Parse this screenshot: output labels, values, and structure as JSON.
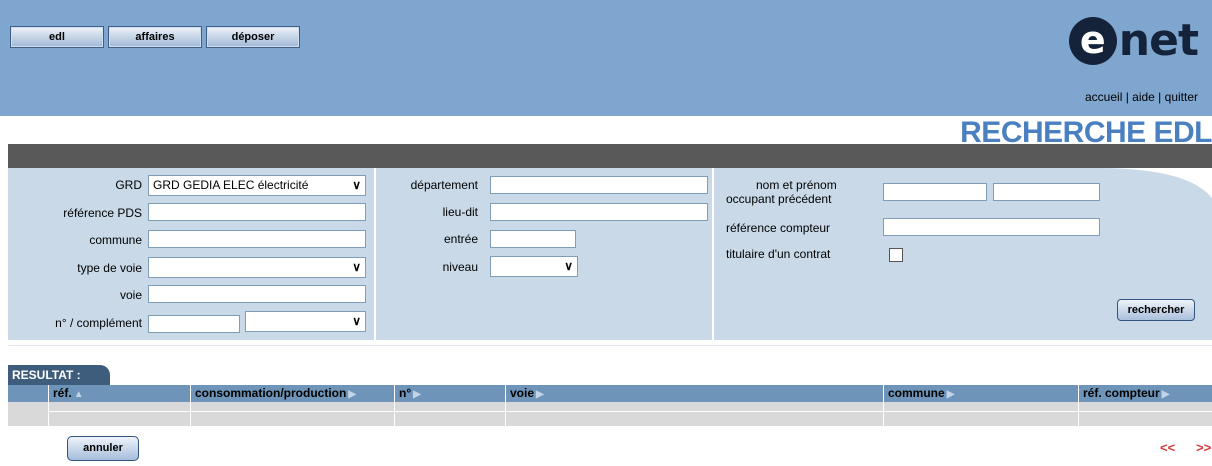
{
  "nav": {
    "edl": "edl",
    "affaires": "affaires",
    "deposer": "déposer"
  },
  "logo": {
    "mark": "e",
    "text": "net"
  },
  "top_links": {
    "accueil": "accueil",
    "sep1": " | ",
    "aide": "aide",
    "sep2": " | ",
    "quitter": "quitter"
  },
  "page_title": "RECHERCHE EDL",
  "form": {
    "grd_label": "GRD",
    "grd_value": "GRD GEDIA ELEC électricité",
    "ref_pds_label": "référence PDS",
    "commune_label": "commune",
    "type_voie_label": "type de voie",
    "voie_label": "voie",
    "num_label": "n° / complément",
    "departement_label": "département",
    "lieu_dit_label": "lieu-dit",
    "entree_label": "entrée",
    "niveau_label": "niveau",
    "nom_prenom_label_1": "nom et prénom",
    "nom_prenom_label_2": "occupant précédent",
    "ref_compteur_label": "référence compteur",
    "titulaire_label": "titulaire d'un contrat",
    "search_button": "rechercher"
  },
  "results": {
    "tab_label": "RESULTAT :",
    "columns": [
      "réf.",
      "consommation/production",
      "n°",
      "voie",
      "commune",
      "réf. compteur"
    ]
  },
  "cancel_button": "annuler",
  "pager": {
    "prev": "<<",
    "next": ">>"
  },
  "colors": {
    "header": "#7fa6cf",
    "panel": "#c9d9e8",
    "title": "#4a7fc0",
    "result_tab": "#3e5c7b",
    "pager": "#d23a3a"
  }
}
